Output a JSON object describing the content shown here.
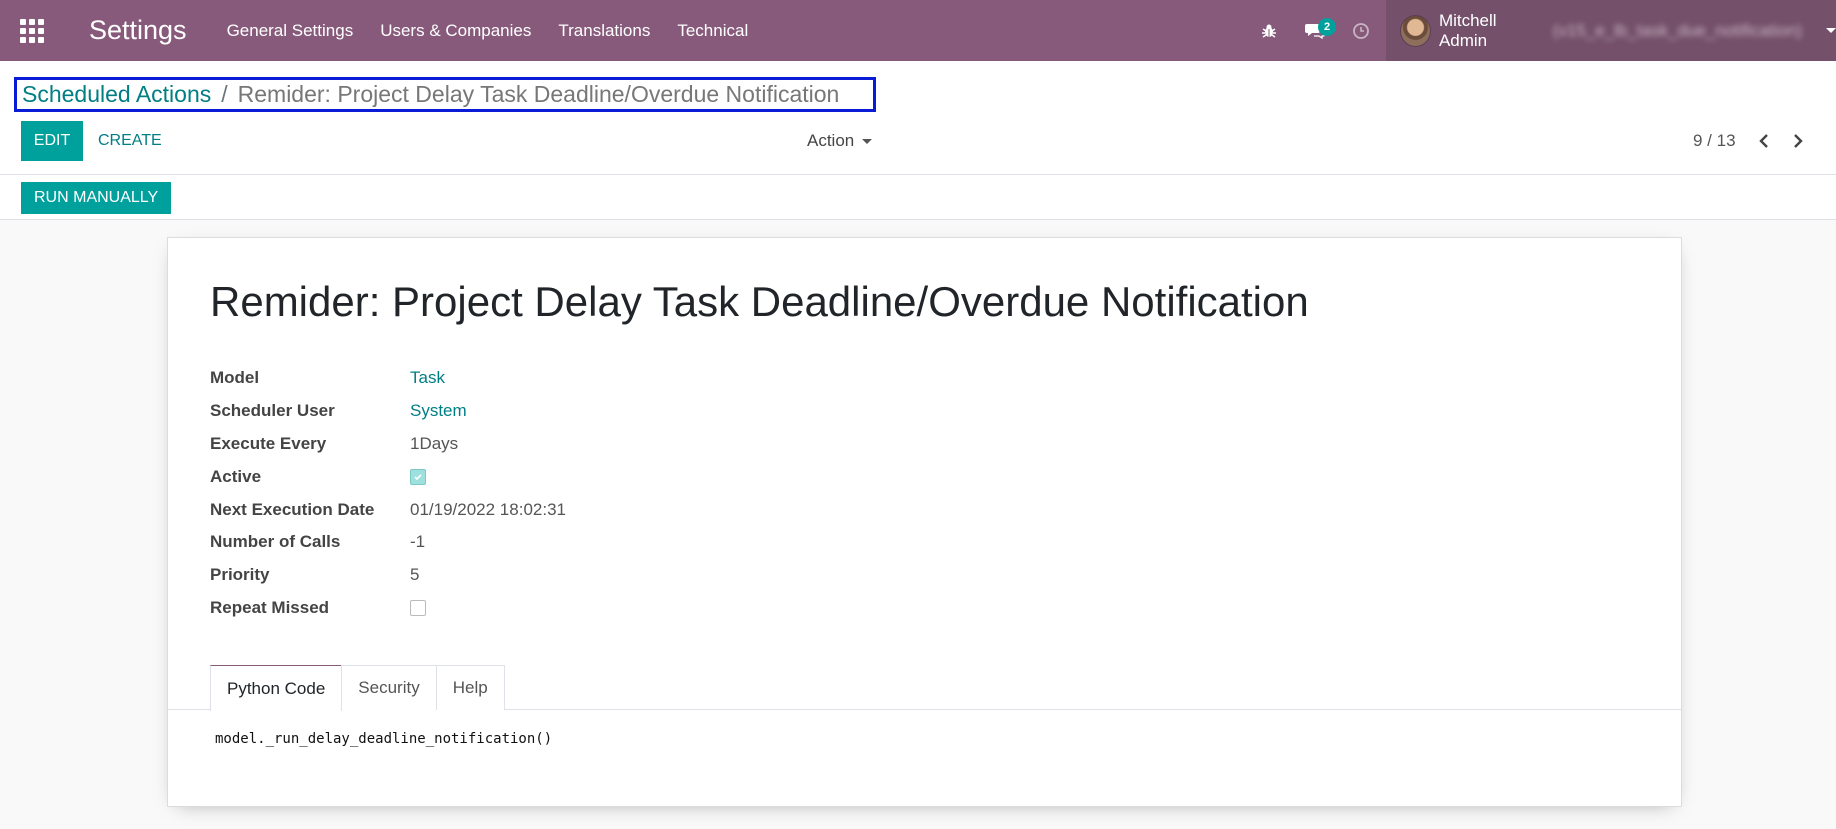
{
  "navbar": {
    "app_title": "Settings",
    "menu": [
      "General Settings",
      "Users & Companies",
      "Translations",
      "Technical"
    ],
    "messages_badge": "2",
    "user_name": "Mitchell Admin",
    "user_db": "(v15_e_lb_task_due_notification)",
    "icons": {
      "apps": "apps-grid-icon",
      "debug": "bug-icon",
      "messages": "chat-icon",
      "activities": "clock-icon"
    }
  },
  "breadcrumb": {
    "parent": "Scheduled Actions",
    "separator": "/",
    "current": "Remider: Project Delay Task Deadline/Overdue Notification"
  },
  "toolbar": {
    "edit_label": "EDIT",
    "create_label": "CREATE",
    "action_label": "Action",
    "pager": "9 / 13"
  },
  "statusbar": {
    "run_label": "RUN MANUALLY"
  },
  "form": {
    "title": "Remider: Project Delay Task Deadline/Overdue Notification",
    "fields": {
      "model": {
        "label": "Model",
        "value": "Task"
      },
      "scheduler_user": {
        "label": "Scheduler User",
        "value": "System"
      },
      "execute_every": {
        "label": "Execute Every",
        "value": "1Days"
      },
      "active": {
        "label": "Active",
        "checked": true
      },
      "next_execution": {
        "label": "Next Execution Date",
        "value": "01/19/2022 18:02:31"
      },
      "number_of_calls": {
        "label": "Number of Calls",
        "value": "-1"
      },
      "priority": {
        "label": "Priority",
        "value": "5"
      },
      "repeat_missed": {
        "label": "Repeat Missed",
        "checked": false
      }
    },
    "tabs": [
      "Python Code",
      "Security",
      "Help"
    ],
    "active_tab": "Python Code",
    "code": "model._run_delay_deadline_notification()"
  },
  "colors": {
    "navbar": "#875a7b",
    "primary": "#00a09d",
    "link": "#017e84",
    "highlight_box": "#0a1bd6"
  }
}
